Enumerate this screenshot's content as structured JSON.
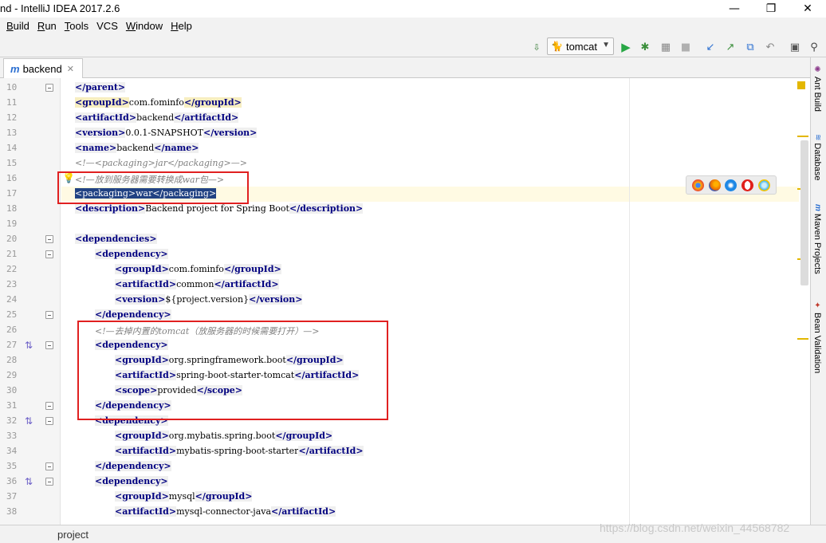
{
  "window": {
    "title": "nd - IntelliJ IDEA 2017.2.6",
    "minimize_glyph": "—",
    "maximize_glyph": "❐",
    "close_glyph": "✕"
  },
  "menu": [
    {
      "label": "Build",
      "mnemonic": "B",
      "rest": "uild"
    },
    {
      "label": "Run",
      "mnemonic": "R",
      "rest": "un"
    },
    {
      "label": "Tools",
      "mnemonic": "T",
      "rest": "ools"
    },
    {
      "label": "VCS",
      "mnemonic": "",
      "rest": "VCS"
    },
    {
      "label": "Window",
      "mnemonic": "W",
      "rest": "indow"
    },
    {
      "label": "Help",
      "mnemonic": "H",
      "rest": "elp"
    }
  ],
  "toolbar": {
    "run_config": "tomcat",
    "icons": [
      "build-icon",
      "run-icon",
      "debug-icon",
      "coverage-icon",
      "stop-icon",
      "vcs-update-icon",
      "vcs-commit-icon",
      "vcs-compare-icon",
      "revert-icon",
      "project-structure-icon",
      "search-everywhere-icon"
    ]
  },
  "editor_tab": {
    "label": "backend",
    "icon": "maven-m-icon"
  },
  "code_lines": [
    {
      "n": "10",
      "indent": 0,
      "parts": [
        [
          "tag",
          "</parent>"
        ]
      ]
    },
    {
      "n": "11",
      "indent": 0,
      "parts": [
        [
          "taghl",
          "<groupId>"
        ],
        [
          "text",
          "com.fominfo"
        ],
        [
          "taghl",
          "</groupId>"
        ]
      ]
    },
    {
      "n": "12",
      "indent": 0,
      "parts": [
        [
          "tag",
          "<artifactId>"
        ],
        [
          "text",
          "backend"
        ],
        [
          "tag",
          "</artifactId>"
        ]
      ]
    },
    {
      "n": "13",
      "indent": 0,
      "parts": [
        [
          "tag",
          "<version>"
        ],
        [
          "text",
          "0.0.1-SNAPSHOT"
        ],
        [
          "tag",
          "</version>"
        ]
      ]
    },
    {
      "n": "14",
      "indent": 0,
      "parts": [
        [
          "tag",
          "<name>"
        ],
        [
          "text",
          "backend"
        ],
        [
          "tag",
          "</name>"
        ]
      ]
    },
    {
      "n": "15",
      "indent": 0,
      "parts": [
        [
          "cmt",
          "<!—<packaging>jar</packaging>—>"
        ]
      ]
    },
    {
      "n": "16",
      "indent": 0,
      "parts": [
        [
          "cmt",
          "<!—放到服务器需要转换成war包—>"
        ]
      ]
    },
    {
      "n": "17",
      "indent": 0,
      "parts": [
        [
          "sel",
          "<packaging>war</packaging>"
        ]
      ]
    },
    {
      "n": "18",
      "indent": 0,
      "parts": [
        [
          "tag",
          "<description>"
        ],
        [
          "text",
          "Backend project for Spring Boot"
        ],
        [
          "tag",
          "</description>"
        ]
      ]
    },
    {
      "n": "19",
      "indent": 0,
      "parts": []
    },
    {
      "n": "20",
      "indent": 0,
      "parts": [
        [
          "tag",
          "<dependencies>"
        ]
      ]
    },
    {
      "n": "21",
      "indent": 1,
      "parts": [
        [
          "tag",
          "<dependency>"
        ]
      ]
    },
    {
      "n": "22",
      "indent": 2,
      "parts": [
        [
          "tag",
          "<groupId>"
        ],
        [
          "text",
          "com.fominfo"
        ],
        [
          "tag",
          "</groupId>"
        ]
      ]
    },
    {
      "n": "23",
      "indent": 2,
      "parts": [
        [
          "tag",
          "<artifactId>"
        ],
        [
          "text",
          "common"
        ],
        [
          "tag",
          "</artifactId>"
        ]
      ]
    },
    {
      "n": "24",
      "indent": 2,
      "parts": [
        [
          "tag",
          "<version>"
        ],
        [
          "text",
          "${project.version}"
        ],
        [
          "tag",
          "</version>"
        ]
      ]
    },
    {
      "n": "25",
      "indent": 1,
      "parts": [
        [
          "tag",
          "</dependency>"
        ]
      ]
    },
    {
      "n": "26",
      "indent": 1,
      "parts": [
        [
          "cmt",
          "<!—去掉内置的tomcat（放服务器的时候需要打开）—>"
        ]
      ]
    },
    {
      "n": "27",
      "indent": 1,
      "parts": [
        [
          "tag",
          "<dependency>"
        ]
      ]
    },
    {
      "n": "28",
      "indent": 2,
      "parts": [
        [
          "tag",
          "<groupId>"
        ],
        [
          "text",
          "org.springframework.boot"
        ],
        [
          "tag",
          "</groupId>"
        ]
      ]
    },
    {
      "n": "29",
      "indent": 2,
      "parts": [
        [
          "tag",
          "<artifactId>"
        ],
        [
          "text",
          "spring-boot-starter-tomcat"
        ],
        [
          "tag",
          "</artifactId>"
        ]
      ]
    },
    {
      "n": "30",
      "indent": 2,
      "parts": [
        [
          "tag",
          "<scope>"
        ],
        [
          "text",
          "provided"
        ],
        [
          "tag",
          "</scope>"
        ]
      ]
    },
    {
      "n": "31",
      "indent": 1,
      "parts": [
        [
          "tag",
          "</dependency>"
        ]
      ]
    },
    {
      "n": "32",
      "indent": 1,
      "parts": [
        [
          "tag",
          "<dependency>"
        ]
      ]
    },
    {
      "n": "33",
      "indent": 2,
      "parts": [
        [
          "tag",
          "<groupId>"
        ],
        [
          "text",
          "org.mybatis.spring.boot"
        ],
        [
          "tag",
          "</groupId>"
        ]
      ]
    },
    {
      "n": "34",
      "indent": 2,
      "parts": [
        [
          "tag",
          "<artifactId>"
        ],
        [
          "text",
          "mybatis-spring-boot-starter"
        ],
        [
          "tag",
          "</artifactId>"
        ]
      ]
    },
    {
      "n": "35",
      "indent": 1,
      "parts": [
        [
          "tag",
          "</dependency>"
        ]
      ]
    },
    {
      "n": "36",
      "indent": 1,
      "parts": [
        [
          "tag",
          "<dependency>"
        ]
      ]
    },
    {
      "n": "37",
      "indent": 2,
      "parts": [
        [
          "tag",
          "<groupId>"
        ],
        [
          "text",
          "mysql"
        ],
        [
          "tag",
          "</groupId>"
        ]
      ]
    },
    {
      "n": "38",
      "indent": 2,
      "parts": [
        [
          "tag",
          "<artifactId>"
        ],
        [
          "text",
          "mysql-connector-java"
        ],
        [
          "tag",
          "</artifactId>"
        ]
      ]
    }
  ],
  "gutter_markers": {
    "fold_lines": [
      "10",
      "20",
      "21",
      "25",
      "27",
      "31",
      "32",
      "35",
      "36"
    ],
    "override_lines": [
      "27",
      "32",
      "36"
    ],
    "bulb_line": "16"
  },
  "browsers": [
    "chrome-icon",
    "firefox-icon",
    "safari-icon",
    "opera-icon",
    "ie-icon"
  ],
  "right_tools": [
    {
      "label": "Ant Build",
      "icon": "ant-icon"
    },
    {
      "label": "Database",
      "icon": "database-icon"
    },
    {
      "label": "Maven Projects",
      "icon": "maven-icon"
    },
    {
      "label": "Bean Validation",
      "icon": "bean-icon"
    }
  ],
  "bottom": {
    "project_label": "project"
  },
  "watermark": "https://blog.csdn.net/weixin_44568782"
}
